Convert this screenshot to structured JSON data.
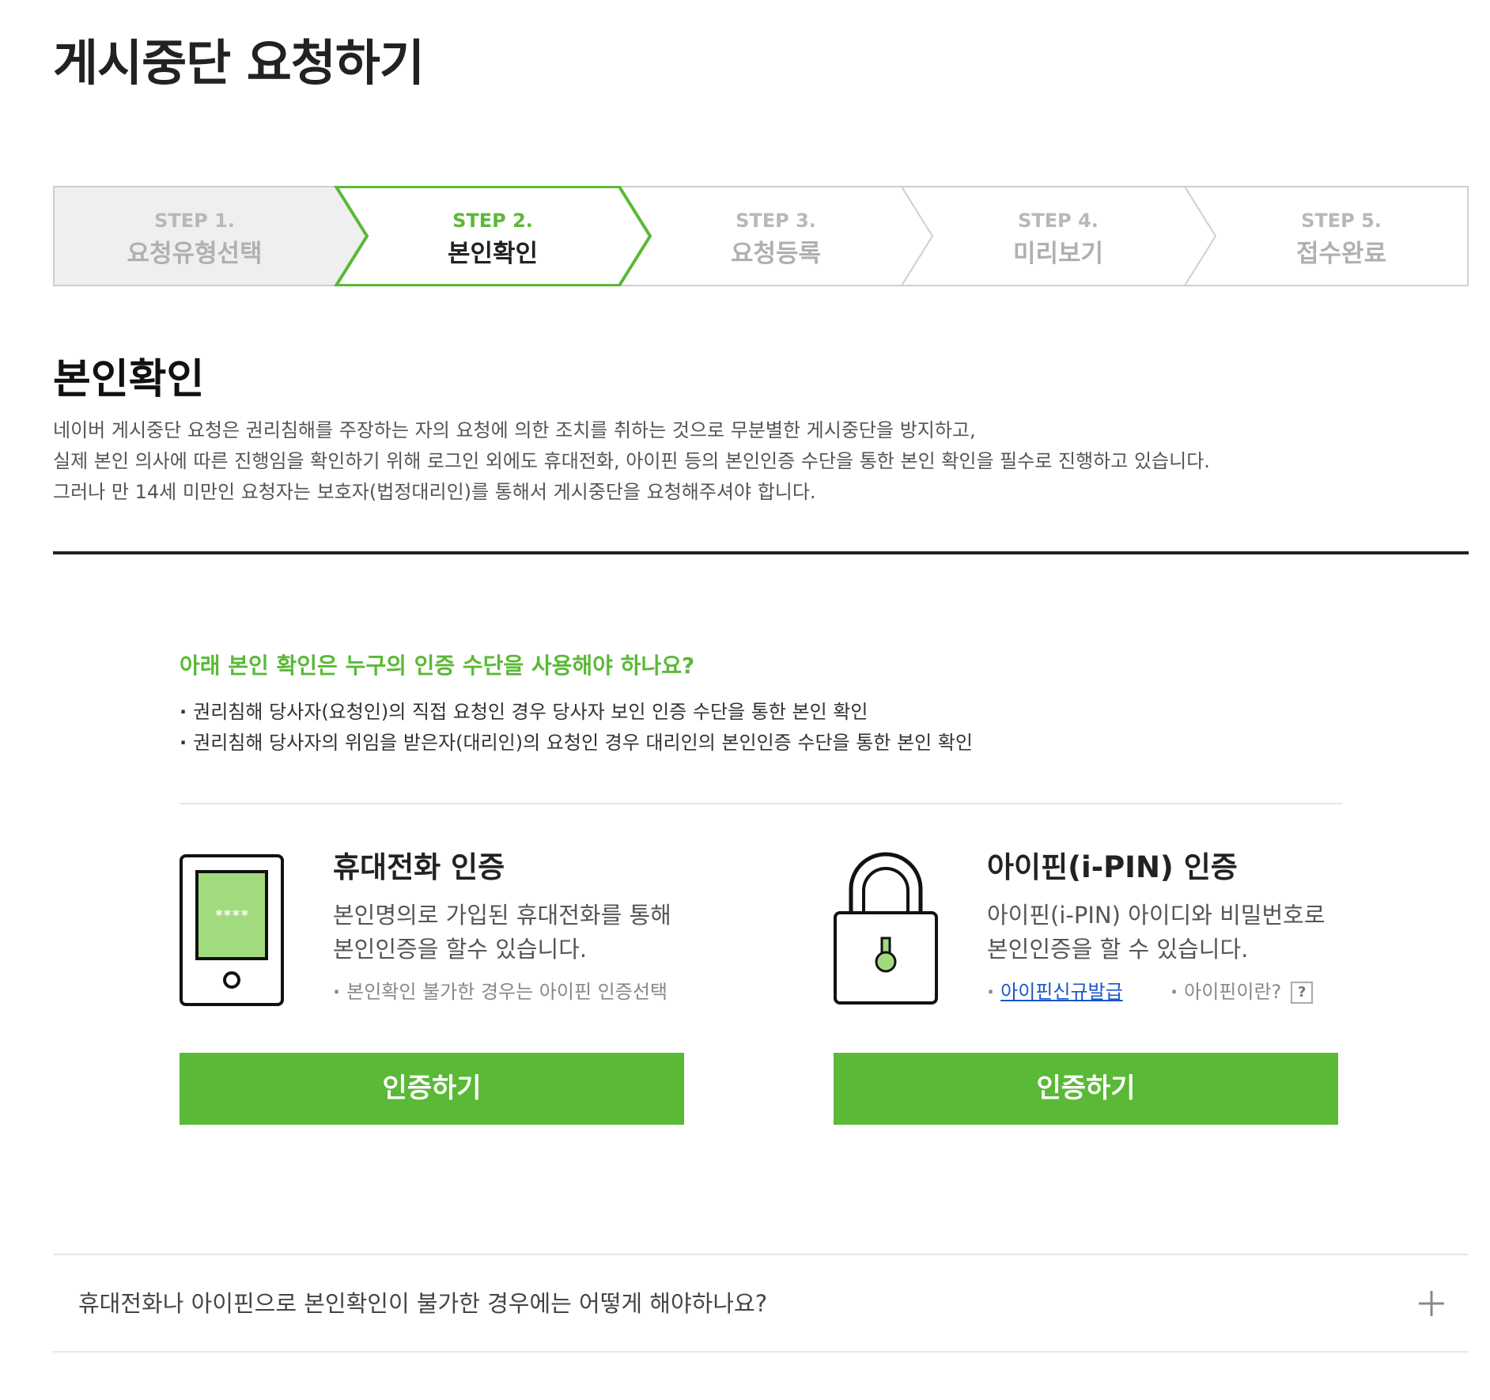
{
  "page": {
    "title": "게시중단 요청하기"
  },
  "steps": [
    {
      "num": "STEP 1.",
      "name": "요청유형선택"
    },
    {
      "num": "STEP 2.",
      "name": "본인확인"
    },
    {
      "num": "STEP 3.",
      "name": "요청등록"
    },
    {
      "num": "STEP 4.",
      "name": "미리보기"
    },
    {
      "num": "STEP 5.",
      "name": "접수완료"
    }
  ],
  "active_step": 2,
  "section": {
    "title": "본인확인",
    "desc": [
      "네이버 게시중단 요청은 권리침해를 주장하는 자의 요청에 의한 조치를 취하는 것으로 무분별한 게시중단을 방지하고,",
      "실제 본인 의사에 따른 진행임을 확인하기 위해 로그인 외에도 휴대전화, 아이핀 등의 본인인증 수단을 통한 본인 확인을 필수로 진행하고 있습니다.",
      "그러나 만 14세 미만인 요청자는 보호자(법정대리인)를 통해서 게시중단을 요청해주셔야 합니다."
    ]
  },
  "auth": {
    "question": "아래 본인 확인은 누구의 인증 수단을 사용해야 하나요?",
    "bullets": [
      "권리침해 당사자(요청인)의 직접 요청인 경우 당사자 보인 인증 수단을 통한 본인 확인",
      "권리침해 당사자의 위임을 받은자(대리인)의 요청인 경우 대리인의 본인인증 수단을 통한 본인 확인"
    ],
    "phone": {
      "icon": "mobile-phone-icon",
      "screen_text": "****",
      "title": "휴대전화 인증",
      "desc": [
        "본인명의로 가입된 휴대전화를 통해",
        "본인인증을 할수 있습니다."
      ],
      "note": "본인확인 불가한 경우는 아이핀 인증선택",
      "button": "인증하기"
    },
    "ipin": {
      "icon": "padlock-icon",
      "title": "아이핀(i-PIN) 인증",
      "desc": [
        "아이핀(i-PIN) 아이디와 비밀번호로",
        "본인인증을 할 수 있습니다."
      ],
      "link": "아이핀신규발급",
      "what": "아이핀이란?",
      "help": "?",
      "button": "인증하기"
    }
  },
  "faq": {
    "question": "휴대전화나 아이핀으로 본인확인이 불가한 경우에는 어떻게 해야하나요?",
    "toggle_icon": "plus-icon"
  },
  "colors": {
    "accent": "#5ab936",
    "link": "#1a57c8",
    "text": "#333333"
  }
}
